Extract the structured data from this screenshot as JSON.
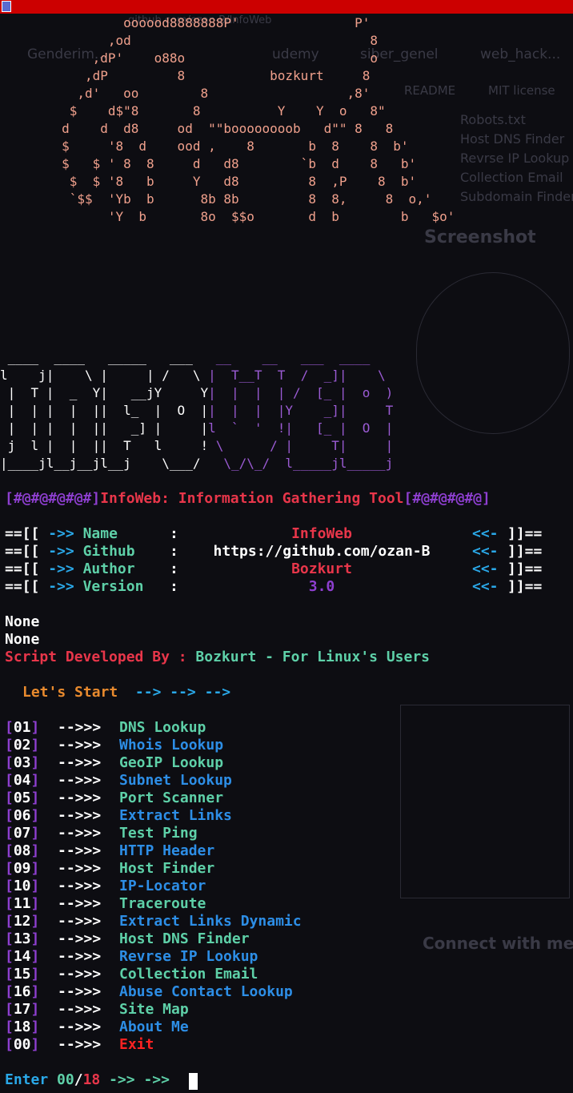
{
  "banner_lines": [
    "                oooood8888888P'               P'",
    "              ,od                               8",
    "            ,dP'    o88o                        o",
    "           ,dP         8           bozkurt     8",
    "          ,d'   oo        8                  ,8'",
    "         $    d$\"8       8          Y    Y  o   8\"",
    "        d    d  d8     od  \"\"boooooooob   d\"\" 8   8",
    "        $     '8  d    ood ,    8       b  8    8  b'",
    "        $   $ ' 8  8     d   d8        `b  d    8   b'",
    "         $  $ '8   b     Y   d8         8  ,P    8  b'",
    "         `$$  'Yb  b      8b 8b         8  8,     8  o,'",
    "              'Y  b       8o  $$o       d  b        b   $o'"
  ],
  "logo_lines": [
    [
      " ____  ____   _____   ___  ",
      " __    __   ___  ____ "
    ],
    [
      "l    j|    \\ |     | /   \\ ",
      "|  T__T  T  /  _]|    \\"
    ],
    [
      " |  T |  _  Y|   __jY     Y",
      "|  |  |  | /  [_ |  o  )"
    ],
    [
      " |  | |  |  ||  l_  |  O  |",
      "|  |  |  |Y    _]|     T"
    ],
    [
      " |  | |  |  ||   _] |     |",
      "l  `  '  !|   [_ |  O  |"
    ],
    [
      " j  l |  |  ||  T   l     !",
      " \\      / |     T|     |"
    ],
    [
      "|____jl__j__jl__j    \\___/ ",
      "  \\_/\\_/  l_____jl_____j"
    ]
  ],
  "title": {
    "left_deco": "[#@#@#@#@#]",
    "text": "InfoWeb: Information Gathering Tool",
    "right_deco": "[#@#@#@#@]"
  },
  "info": [
    {
      "prefix": "==[[",
      "arrow": "->>",
      "key": "Name     ",
      "sep": ":",
      "value": "InfoWeb",
      "tail_arrow": "<<-",
      "suffix": "]]=="
    },
    {
      "prefix": "==[[",
      "arrow": "->>",
      "key": "Github   ",
      "sep": ":",
      "value": "https://github.com/ozan-B",
      "tail_arrow": "<<-",
      "suffix": "]]=="
    },
    {
      "prefix": "==[[",
      "arrow": "->>",
      "key": "Author   ",
      "sep": ":",
      "value": "Bozkurt",
      "tail_arrow": "<<-",
      "suffix": "]]=="
    },
    {
      "prefix": "==[[",
      "arrow": "->>",
      "key": "Version  ",
      "sep": ":",
      "value": "3.0",
      "tail_arrow": "<<-",
      "suffix": "]]=="
    }
  ],
  "none_lines": [
    "None",
    "None"
  ],
  "developed": {
    "label": "Script Developed By :",
    "value": "Bozkurt - For Linux's Users"
  },
  "start": {
    "label": "Let's Start",
    "arrows": "--> --> -->"
  },
  "menu": [
    {
      "num": "01",
      "label": "DNS Lookup",
      "color": "green"
    },
    {
      "num": "02",
      "label": "Whois Lookup",
      "color": "blue"
    },
    {
      "num": "03",
      "label": "GeoIP Lookup",
      "color": "green"
    },
    {
      "num": "04",
      "label": "Subnet Lookup",
      "color": "blue"
    },
    {
      "num": "05",
      "label": "Port Scanner",
      "color": "green"
    },
    {
      "num": "06",
      "label": "Extract Links",
      "color": "blue"
    },
    {
      "num": "07",
      "label": "Test Ping",
      "color": "green"
    },
    {
      "num": "08",
      "label": "HTTP Header",
      "color": "blue"
    },
    {
      "num": "09",
      "label": "Host Finder",
      "color": "green"
    },
    {
      "num": "10",
      "label": "IP-Locator",
      "color": "blue"
    },
    {
      "num": "11",
      "label": "Traceroute",
      "color": "green"
    },
    {
      "num": "12",
      "label": "Extract Links Dynamic",
      "color": "blue"
    },
    {
      "num": "13",
      "label": "Host DNS Finder",
      "color": "green"
    },
    {
      "num": "14",
      "label": "Revrse IP Lookup",
      "color": "blue"
    },
    {
      "num": "15",
      "label": "Collection Email",
      "color": "green"
    },
    {
      "num": "16",
      "label": "Abuse Contact Lookup",
      "color": "blue"
    },
    {
      "num": "17",
      "label": "Site Map",
      "color": "green"
    },
    {
      "num": "18",
      "label": "About Me",
      "color": "blue"
    },
    {
      "num": "00",
      "label": "Exit",
      "color": "red"
    }
  ],
  "menu_arrow": "-->>>",
  "prompt": {
    "label": "Enter",
    "zero": "00",
    "slash": "/",
    "max": "18",
    "arrows": "->> ->>"
  },
  "background_page": {
    "url": "github.com/ozan-B/InfoWeb",
    "bookmarks": [
      "Genderim...",
      "udemy",
      "siber_genel",
      "web_hack..."
    ],
    "readme": "README",
    "license": "MIT license",
    "toc": [
      "Robots.txt",
      "Host DNS Finder",
      "Revrse IP Lookup",
      "Collection Email",
      "Subdomain Finder"
    ],
    "screenshot_heading": "Screenshot",
    "connect_heading": "Connect with me"
  },
  "colors": {
    "topbar": "#cc0000",
    "background": "#0d0d12",
    "purple": "#8e3fd0",
    "green": "#5ed0a8",
    "blue": "#2d8ee6",
    "red": "#e8364a"
  }
}
